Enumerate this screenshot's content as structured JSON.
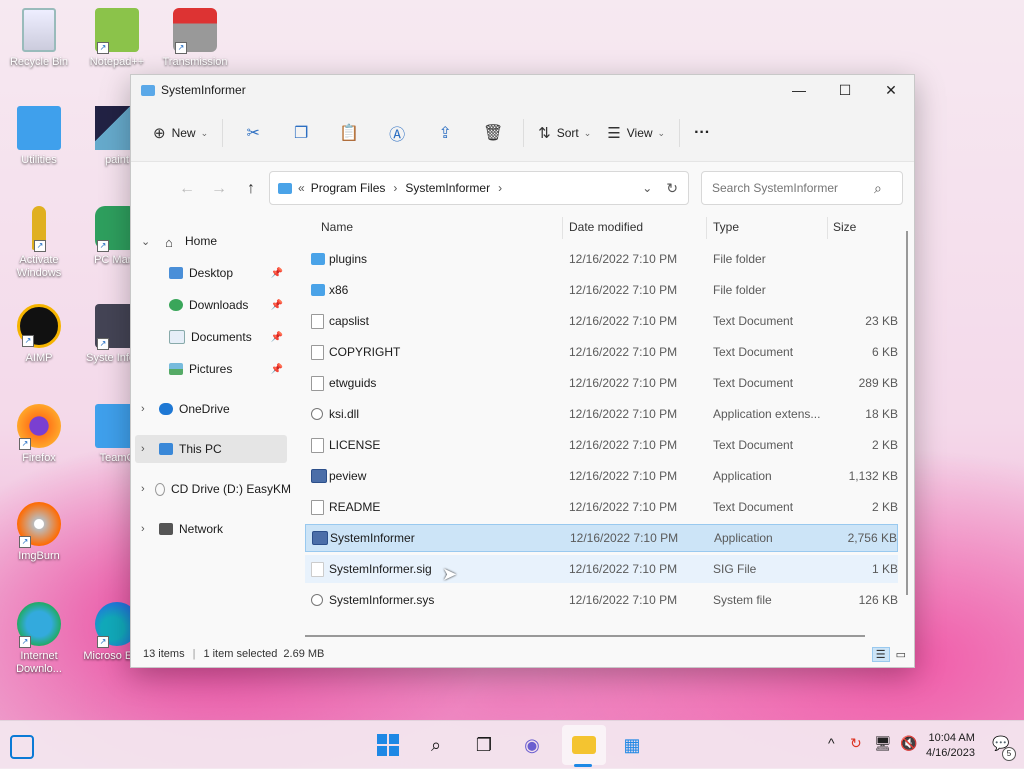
{
  "desktop": {
    "icons": [
      {
        "label": "Recycle Bin"
      },
      {
        "label": "Notepad++"
      },
      {
        "label": "Transmission"
      },
      {
        "label": "Utilities"
      },
      {
        "label": "paint"
      },
      {
        "label": "Activate Windows"
      },
      {
        "label": "PC Mana"
      },
      {
        "label": "AIMP"
      },
      {
        "label": "Syste Inform"
      },
      {
        "label": "Firefox"
      },
      {
        "label": "TeamC"
      },
      {
        "label": "ImgBurn"
      },
      {
        "label": "Internet Downlo..."
      },
      {
        "label": "Microso Edge"
      }
    ]
  },
  "window": {
    "title": "SystemInformer",
    "toolbar": {
      "new_label": "New",
      "sort_label": "Sort",
      "view_label": "View",
      "more_label": "···"
    },
    "address": {
      "overflow": "«",
      "crumbs": [
        "Program Files",
        "SystemInformer"
      ]
    },
    "search": {
      "placeholder": "Search SystemInformer"
    },
    "sidebar": {
      "home": "Home",
      "quick": [
        "Desktop",
        "Downloads",
        "Documents",
        "Pictures"
      ],
      "onedrive": "OneDrive",
      "thispc": "This PC",
      "cd": "CD Drive (D:) EasyKM",
      "network": "Network"
    },
    "columns": {
      "name": "Name",
      "date": "Date modified",
      "type": "Type",
      "size": "Size"
    },
    "files": [
      {
        "name": "plugins",
        "date": "12/16/2022 7:10 PM",
        "type": "File folder",
        "size": "",
        "kind": "folder"
      },
      {
        "name": "x86",
        "date": "12/16/2022 7:10 PM",
        "type": "File folder",
        "size": "",
        "kind": "folder"
      },
      {
        "name": "capslist",
        "date": "12/16/2022 7:10 PM",
        "type": "Text Document",
        "size": "23 KB",
        "kind": "doc"
      },
      {
        "name": "COPYRIGHT",
        "date": "12/16/2022 7:10 PM",
        "type": "Text Document",
        "size": "6 KB",
        "kind": "doc"
      },
      {
        "name": "etwguids",
        "date": "12/16/2022 7:10 PM",
        "type": "Text Document",
        "size": "289 KB",
        "kind": "doc"
      },
      {
        "name": "ksi.dll",
        "date": "12/16/2022 7:10 PM",
        "type": "Application extens...",
        "size": "18 KB",
        "kind": "gear"
      },
      {
        "name": "LICENSE",
        "date": "12/16/2022 7:10 PM",
        "type": "Text Document",
        "size": "2 KB",
        "kind": "doc"
      },
      {
        "name": "peview",
        "date": "12/16/2022 7:10 PM",
        "type": "Application",
        "size": "1,132 KB",
        "kind": "app"
      },
      {
        "name": "README",
        "date": "12/16/2022 7:10 PM",
        "type": "Text Document",
        "size": "2 KB",
        "kind": "doc"
      },
      {
        "name": "SystemInformer",
        "date": "12/16/2022 7:10 PM",
        "type": "Application",
        "size": "2,756 KB",
        "kind": "app"
      },
      {
        "name": "SystemInformer.sig",
        "date": "12/16/2022 7:10 PM",
        "type": "SIG File",
        "size": "1 KB",
        "kind": "doc"
      },
      {
        "name": "SystemInformer.sys",
        "date": "12/16/2022 7:10 PM",
        "type": "System file",
        "size": "126 KB",
        "kind": "gear"
      }
    ],
    "status": {
      "items": "13 items",
      "selected": "1 item selected",
      "size": "2.69 MB"
    }
  },
  "taskbar": {
    "time": "10:04 AM",
    "date": "4/16/2023",
    "notifications": "5"
  }
}
